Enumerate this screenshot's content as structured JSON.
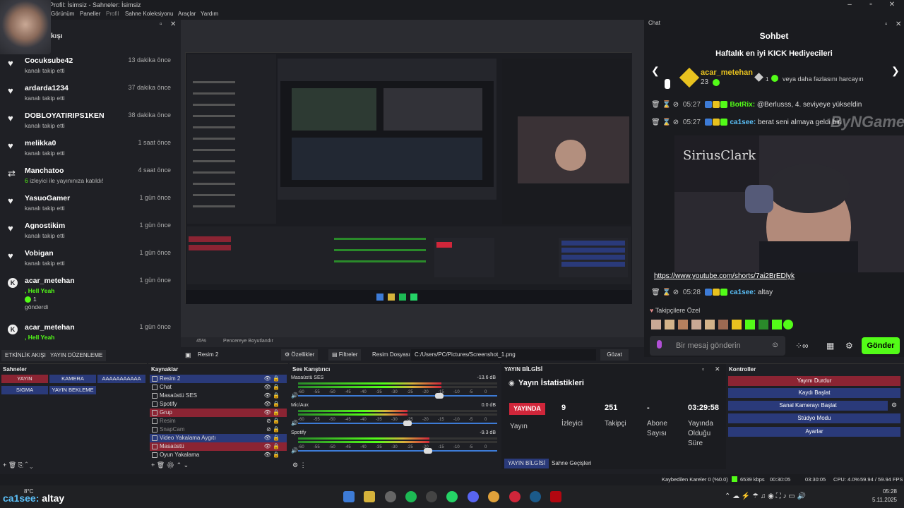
{
  "window": {
    "title": "Profil: İsimsiz - Sahneler: İsimsiz"
  },
  "menu": [
    "Görünüm",
    "Paneller",
    "Profil",
    "Sahne Koleksiyonu",
    "Araçlar",
    "Yardım"
  ],
  "feed": {
    "header": "kışı",
    "items": [
      {
        "name": "Cocuksube42",
        "time": "13 dakika önce",
        "sub": "kanalı takip etti",
        "icon": "heart-icon"
      },
      {
        "name": "ardarda1234",
        "time": "37 dakika önce",
        "sub": "kanalı takip etti",
        "icon": "heart-icon"
      },
      {
        "name": "DOBLOYATIRIPS1KEN",
        "time": "38 dakika önce",
        "sub": "kanalı takip etti",
        "icon": "heart-icon"
      },
      {
        "name": "melikka0",
        "time": "1 saat önce",
        "sub": "kanalı takip etti",
        "icon": "heart-icon"
      },
      {
        "name": "Manchatoo",
        "time": "4 saat önce",
        "sub_count": "6",
        "sub": " izleyici ile yayınınıza katıldı!",
        "icon": "raid-icon"
      },
      {
        "name": "YasuoGamer",
        "time": "1 gün önce",
        "sub": "kanalı takip etti",
        "icon": "heart-icon"
      },
      {
        "name": "Agnostikim",
        "time": "1 gün önce",
        "sub": "kanalı takip etti",
        "icon": "heart-icon"
      },
      {
        "name": "Vobigan",
        "time": "1 gün önce",
        "sub": "kanalı takip etti",
        "icon": "heart-icon"
      },
      {
        "name": "acar_metehan",
        "time": "1 gün önce",
        "sub": ", Hell Yeah",
        "gift_count": "1",
        "gift_label": "gönderdi",
        "icon": "kick-icon"
      },
      {
        "name": "acar_metehan",
        "time": "1 gün önce",
        "sub": ", Hell Yeah",
        "icon": "kick-icon"
      }
    ]
  },
  "activity_tabs": [
    "ETKİNLİK AKIŞI",
    "YAYIN DÜZENLEME"
  ],
  "preview": {
    "zoom": "45%",
    "mode": "Pencereye Boyutlandır"
  },
  "props": {
    "source": "Resim 2",
    "props_btn": "Özellikler",
    "filters_btn": "Filtreler",
    "file_label": "Resim Dosyası",
    "file_path": "C:/Users/PC/Pictures/Screenshot_1.png",
    "browse_btn": "Gözat"
  },
  "chat": {
    "tab": "Chat",
    "title": "Sohbet",
    "gifters_title": "Haftalık en iyi KICK Hediyecileri",
    "top_gifter": "acar_metehan",
    "top_gifter_count": "23",
    "gift_hint_count": "1",
    "gift_hint": "veya daha fazlasını harcayın",
    "lines": [
      {
        "time": "05:27",
        "user": "BotRix:",
        "msg": " @Berlusss, 4. seviyeye yükseldin"
      },
      {
        "time": "05:27",
        "user": "ca1see:",
        "msg": " berat seni almaya geldi biri"
      }
    ],
    "link": "https://www.youtube.com/shorts/7ai2BrEDlyk",
    "last": {
      "time": "05:28",
      "user": "ca1see:",
      "msg": " altay"
    },
    "followers_only": "Takipçilere Özel",
    "input_placeholder": "Bir mesaj gönderin",
    "send": "Gönder",
    "watermark": "ByNGame"
  },
  "scenes": {
    "title": "Sahneler",
    "items": [
      "YAYIN",
      "KAMERA",
      "AAAAAAAAAAA",
      "SIGMA",
      "YAYIN BEKLEME"
    ]
  },
  "sources": {
    "title": "Kaynaklar",
    "items": [
      "Resim 2",
      "Chat",
      "Masaüstü SES",
      "Spotify",
      "Grup",
      "Resim",
      "SnapCam",
      "Video Yakalama Aygıtı",
      "Masaüstü",
      "Oyun Yakalama"
    ]
  },
  "mixer": {
    "title": "Ses Karıştırıcı",
    "scale": [
      "-60",
      "-55",
      "-50",
      "-45",
      "-40",
      "-35",
      "-30",
      "-25",
      "-20",
      "-15",
      "-10",
      "-5",
      "0"
    ],
    "channels": [
      {
        "name": "Masaüstü SES",
        "db": "-13.6 dB",
        "level": 0.72
      },
      {
        "name": "Mic/Aux",
        "db": "0.0 dB",
        "level": 0.55
      },
      {
        "name": "Spotify",
        "db": "-9.3 dB",
        "level": 0.66
      }
    ]
  },
  "stats": {
    "title": "YAYIN BİLGİSİ",
    "heading": "Yayın İstatistikleri",
    "live": "YAYINDA",
    "live_sub": "Yayın",
    "viewers": "9",
    "viewers_lbl": "İzleyici",
    "followers": "251",
    "followers_lbl": "Takipçi",
    "subs": "-",
    "subs_lbl": "Abone Sayısı",
    "uptime": "03:29:58",
    "uptime_lbl": "Yayında Olduğu Süre",
    "tabs": [
      "YAYIN BİLGİSİ",
      "Sahne Geçişleri"
    ]
  },
  "controls": {
    "title": "Kontroller",
    "items": [
      "Yayını Durdur",
      "Kaydı Başlat",
      "Sanal Kamerayı Başlat",
      "Stüdyo Modu",
      "Ayarlar"
    ]
  },
  "status": {
    "dropped": "Kaybedilen Kareler 0 (%0.0)",
    "kbps": "6539 kbps",
    "rec": "00:30:05",
    "live": "03:30:05",
    "cpu": "CPU: 4.0%",
    "fps": "59.94 / 59.94 FPS"
  },
  "taskbar": {
    "weather": "8°C",
    "overlay_user": "ca1see:",
    "overlay_msg": " altay",
    "time": "05:28",
    "date": "5.11.2025"
  },
  "colors": {
    "kick_green": "#53fc18",
    "accent_red": "#8b2433",
    "scene_blue": "#2a3a7a"
  }
}
